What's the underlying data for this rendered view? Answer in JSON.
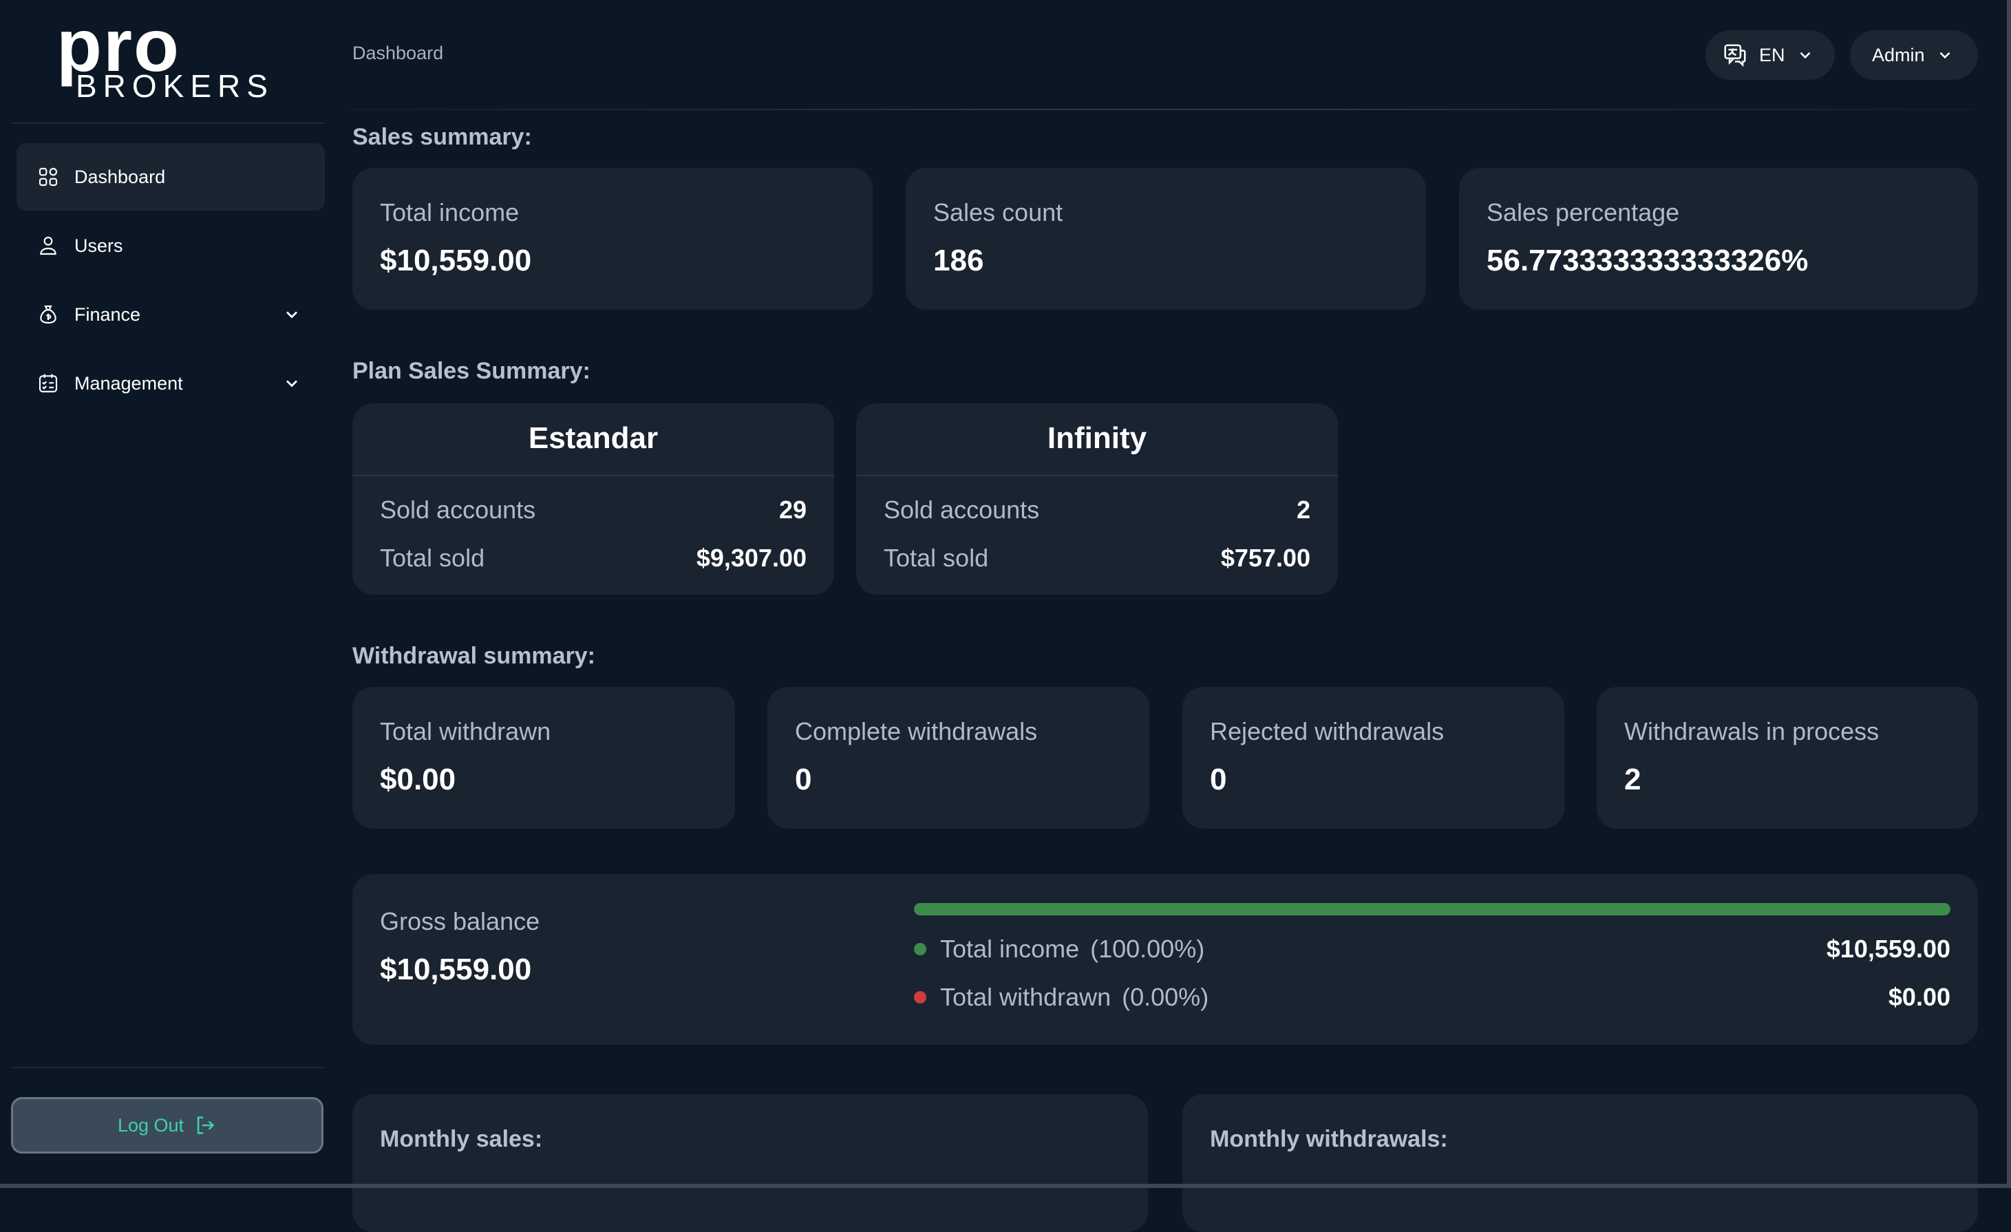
{
  "brand": {
    "logo_top": "pro",
    "logo_bottom": "BROKERS"
  },
  "sidebar": {
    "items": [
      {
        "label": "Dashboard",
        "icon": "dashboard-grid-icon",
        "active": true
      },
      {
        "label": "Users",
        "icon": "user-icon"
      },
      {
        "label": "Finance",
        "icon": "money-bag-icon"
      },
      {
        "label": "Management",
        "icon": "checklist-icon"
      }
    ],
    "logout_label": "Log Out"
  },
  "header": {
    "breadcrumb": "Dashboard",
    "language": "EN",
    "user": "Admin"
  },
  "sales_summary": {
    "title": "Sales summary:",
    "cards": [
      {
        "label": "Total income",
        "value": "$10,559.00"
      },
      {
        "label": "Sales count",
        "value": "186"
      },
      {
        "label": "Sales percentage",
        "value": "56.773333333333326%"
      }
    ]
  },
  "plan_sales": {
    "title": "Plan Sales Summary:",
    "plans": [
      {
        "name": "Estandar",
        "sold_label": "Sold accounts",
        "sold": "29",
        "total_label": "Total sold",
        "total": "$9,307.00"
      },
      {
        "name": "Infinity",
        "sold_label": "Sold accounts",
        "sold": "2",
        "total_label": "Total sold",
        "total": "$757.00"
      }
    ]
  },
  "withdrawal_summary": {
    "title": "Withdrawal summary:",
    "cards": [
      {
        "label": "Total withdrawn",
        "value": "$0.00"
      },
      {
        "label": "Complete withdrawals",
        "value": "0"
      },
      {
        "label": "Rejected withdrawals",
        "value": "0"
      },
      {
        "label": "Withdrawals in process",
        "value": "2"
      }
    ]
  },
  "gross_balance": {
    "label": "Gross balance",
    "value": "$10,559.00",
    "income_share": 1.0,
    "legend": [
      {
        "label": "Total income",
        "pct": "(100.00%)",
        "amount": "$10,559.00",
        "color": "#3d8a4a"
      },
      {
        "label": "Total withdrawn",
        "pct": "(0.00%)",
        "amount": "$0.00",
        "color": "#d13c3c"
      }
    ]
  },
  "monthly": {
    "sales_title": "Monthly sales:",
    "withdrawals_title": "Monthly withdrawals:"
  },
  "colors": {
    "accent": "#3fd2a8",
    "background": "#0b1725",
    "card": "#1a2330"
  }
}
